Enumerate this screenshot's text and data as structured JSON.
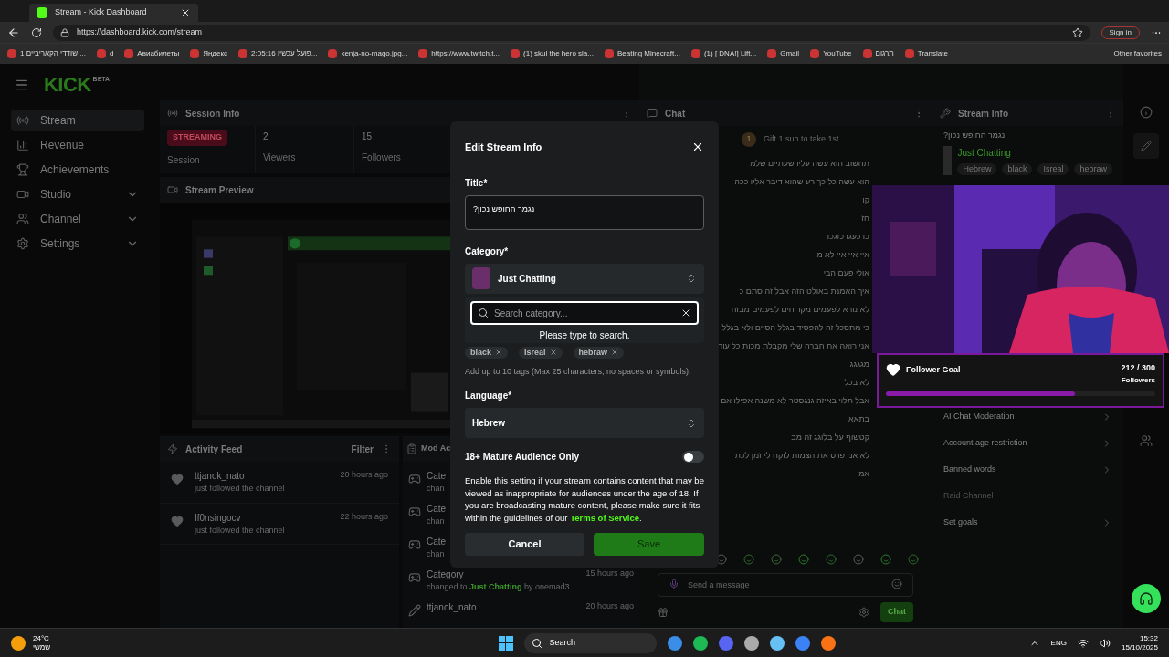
{
  "browser": {
    "tab_title": "Stream - Kick Dashboard",
    "url": "https://dashboard.kick.com/stream",
    "sign_in": "Sign in",
    "bookmarks": [
      "שודדי הקאריביים 1 ...",
      "d",
      "Авиабилеты",
      "Яндекс",
      "2:05:16 פועל עכשיו...",
      "kenja-no-mago.jpg...",
      "https://www.twitch.t...",
      "(1) skul the hero sla...",
      "Beating Minecraft...",
      "(1) [ DNA!] Lift...",
      "Gmail",
      "YouTube",
      "תרגום",
      "Translate"
    ],
    "other_favorites": "Other favorites"
  },
  "logo": {
    "text": "KICK",
    "badge": "BETA"
  },
  "sidebar": {
    "items": [
      {
        "label": "Stream",
        "selected": true,
        "expandable": false
      },
      {
        "label": "Revenue",
        "selected": false,
        "expandable": false
      },
      {
        "label": "Achievements",
        "selected": false,
        "expandable": false
      },
      {
        "label": "Studio",
        "selected": false,
        "expandable": true
      },
      {
        "label": "Channel",
        "selected": false,
        "expandable": true
      },
      {
        "label": "Settings",
        "selected": false,
        "expandable": true
      }
    ]
  },
  "session_info": {
    "title": "Session Info",
    "status": "STREAMING",
    "status_label": "Session",
    "stats": [
      {
        "value": "2",
        "label": "Viewers"
      },
      {
        "value": "15",
        "label": "Followers"
      }
    ]
  },
  "stream_preview": {
    "title": "Stream Preview"
  },
  "activity_feed": {
    "title": "Activity Feed",
    "filter": "Filter",
    "items": [
      {
        "user": "ttjanok_nato",
        "action": "just followed the channel",
        "time": "20 hours ago"
      },
      {
        "user": "If0nsingocv",
        "action": "just followed the channel",
        "time": "22 hours ago"
      }
    ]
  },
  "mod_actions": {
    "title": "Mod Ac",
    "items": [
      {
        "kind": "category",
        "title": "Cate",
        "detail": "chan"
      },
      {
        "kind": "category",
        "title": "Cate",
        "detail": "chan"
      },
      {
        "kind": "category",
        "title": "Cate",
        "detail": "chan"
      },
      {
        "kind": "category",
        "title": "Category",
        "detail": "changed to **Just Chatting** by onemad3",
        "time": "15 hours ago"
      },
      {
        "kind": "user",
        "title": "ttjanok_nato",
        "time": "20 hours ago"
      }
    ]
  },
  "chat": {
    "title": "Chat",
    "pinned_badge": "1",
    "pinned": "Gift 1 sub to take 1st",
    "messages": [
      "תחשוב הוא עשה עליו שעתיים שלמ",
      "הוא עשה כל כך רע שהוא דיבר אליו ככה",
      "קו",
      "חז",
      "כדכעגדכזגכד",
      "איי איי איי לא מ",
      "אולי פעם הבי",
      "איך האמנת באולט הזה אבל זה סתם כ",
      "לא נורא לפעמים מקריחים לפעמים מבזה",
      "כי מתסכל זה להפסיד בגלל הסיים ולא בגלל",
      "אני רואה את חברה שלי מקבלת מכות כל עוד",
      "מגגגג",
      "לא בכל",
      "אבל תלוי באיזה גנגסטר לא משנה אפילו אם",
      "בתאא",
      "קטשוף על בלוגג זה מב",
      "לא אני פרס את הצמות לוקח לי זמן לכת",
      "אמ"
    ],
    "input_placeholder": "Send a message",
    "send": "Chat"
  },
  "stream_info": {
    "title": "Stream Info",
    "stream_title": "נגמר החופש נכון?",
    "category": "Just Chatting",
    "tags": [
      "Hebrew",
      "black",
      "Isreal",
      "hebraw"
    ],
    "settings": [
      {
        "label": "AI Chat Moderation",
        "disabled": false
      },
      {
        "label": "Account age restriction",
        "disabled": false
      },
      {
        "label": "Banned words",
        "disabled": false
      },
      {
        "label": "Raid Channel",
        "disabled": true
      },
      {
        "label": "Set goals",
        "disabled": false
      }
    ]
  },
  "follower_goal": {
    "title": "Follower Goal",
    "count": "212 / 300",
    "unit": "Followers",
    "level": 0.7
  },
  "modal": {
    "title": "Edit Stream Info",
    "title_label": "Title*",
    "title_value": "נגמר החופש נכון?",
    "category_label": "Category*",
    "category": "Just Chatting",
    "dropdown_open": true,
    "search_placeholder": "Search category...",
    "search_hint": "Please type to search.",
    "tags": [
      "black",
      "Isreal",
      "hebraw"
    ],
    "tags_help": "Add up to 10 tags (Max 25 characters, no spaces or symbols).",
    "language_label": "Language*",
    "language": "Hebrew",
    "mature": {
      "label": "18+ Mature Audience Only",
      "on": false
    },
    "mature_help": "Enable this setting if your stream contains content that may be viewed as inappropriate for audiences under the age of 18. If you are broadcasting mature content, please make sure it fits within the guidelines of our ",
    "tos_link": "Terms of Service",
    "tos_end": ".",
    "cancel": "Cancel",
    "save": "Save"
  },
  "taskbar": {
    "temperature": "24°C",
    "weather": "שמשי",
    "search": "Search",
    "language": "ENG",
    "time": "15:32",
    "date": "15/10/2025"
  }
}
